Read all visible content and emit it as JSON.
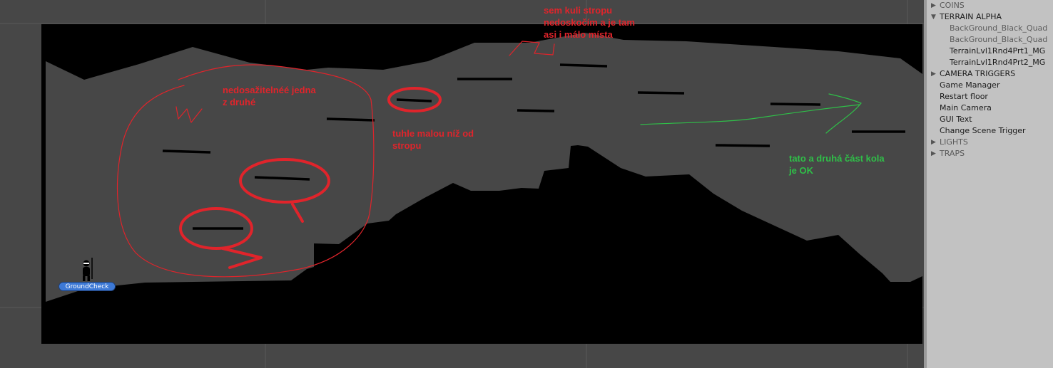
{
  "scene": {
    "groundcheck_label": "GroundCheck",
    "annotations": {
      "top": "sem kuli stropu\nnedoskočím a je tam\nasi i málo místa",
      "left": "nedosažitelnéé jedna\nz druhé",
      "middle": "tuhle malou níž od\nstropu",
      "right": "tato a druhá část kola\nje OK"
    },
    "colors": {
      "background": "#474747",
      "terrain_fill": "#474747",
      "void": "#000000",
      "red_annotation": "#e0242b",
      "green_annotation": "#2fbf48"
    }
  },
  "hierarchy": {
    "items": [
      {
        "label": "COINS",
        "arrow": "▶",
        "kind": "collapsed"
      },
      {
        "label": "TERRAIN ALPHA",
        "arrow": "▼",
        "kind": "expanded"
      },
      {
        "label": "BackGround_Black_Quad",
        "arrow": "",
        "kind": "child"
      },
      {
        "label": "BackGround_Black_Quad",
        "arrow": "",
        "kind": "child"
      },
      {
        "label": "TerrainLvl1Rnd4Prt1_MG",
        "arrow": "",
        "kind": "child-dark"
      },
      {
        "label": "TerrainLvl1Rnd4Prt2_MG",
        "arrow": "",
        "kind": "child-dark"
      },
      {
        "label": "CAMERA TRIGGERS",
        "arrow": "▶",
        "kind": "expanded"
      },
      {
        "label": "Game Manager",
        "arrow": "",
        "kind": "item"
      },
      {
        "label": "Restart floor",
        "arrow": "",
        "kind": "item"
      },
      {
        "label": "Main Camera",
        "arrow": "",
        "kind": "item"
      },
      {
        "label": "GUI Text",
        "arrow": "",
        "kind": "item"
      },
      {
        "label": "Change Scene Trigger",
        "arrow": "",
        "kind": "item"
      },
      {
        "label": "LIGHTS",
        "arrow": "▶",
        "kind": "collapsed"
      },
      {
        "label": "TRAPS",
        "arrow": "▶",
        "kind": "collapsed"
      }
    ]
  }
}
